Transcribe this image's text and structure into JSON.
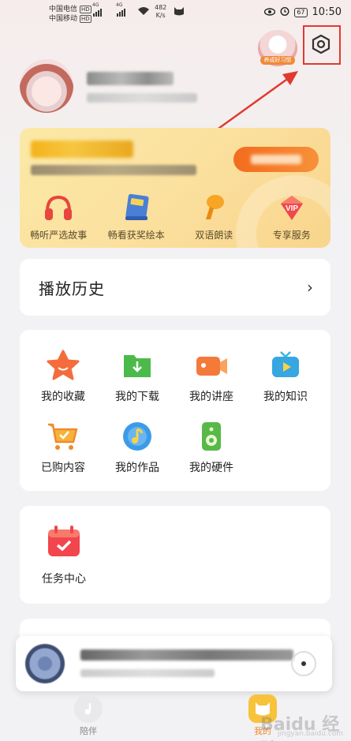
{
  "status_bar": {
    "carrier1": "中国电信",
    "carrier2": "中国移动",
    "hd": "HD",
    "network1": "4G",
    "network2": "4G",
    "speed_value": "482",
    "speed_unit": "K/s",
    "battery": "67",
    "time": "10:50"
  },
  "header": {
    "badge_label": "养成好习惯",
    "settings_icon": "gear-icon"
  },
  "vip": {
    "features": [
      {
        "label": "畅听严选故事",
        "icon": "headphones-icon"
      },
      {
        "label": "畅看获奖绘本",
        "icon": "book-icon"
      },
      {
        "label": "双语朗读",
        "icon": "microphone-icon"
      },
      {
        "label": "专享服务",
        "icon": "vip-gem-icon",
        "badge": "VIP"
      }
    ]
  },
  "history": {
    "title": "播放历史",
    "chevron": "›"
  },
  "grid": {
    "items": [
      {
        "label": "我的收藏",
        "icon": "star-icon"
      },
      {
        "label": "我的下载",
        "icon": "download-folder-icon"
      },
      {
        "label": "我的讲座",
        "icon": "video-camera-icon"
      },
      {
        "label": "我的知识",
        "icon": "tv-play-icon"
      },
      {
        "label": "已购内容",
        "icon": "shopping-cart-icon"
      },
      {
        "label": "我的作品",
        "icon": "music-disc-icon"
      },
      {
        "label": "我的硬件",
        "icon": "speaker-device-icon"
      }
    ]
  },
  "task": {
    "label": "任务中心",
    "icon": "calendar-check-icon"
  },
  "tabbar": {
    "tabs": [
      {
        "label": "陪伴",
        "icon": "music-note-icon"
      },
      {
        "label": "我的",
        "icon": "cat-face-icon"
      }
    ]
  },
  "watermark": {
    "main": "Baidu 经验",
    "sub": "jingyan.baidu.com"
  },
  "colors": {
    "highlight_box": "#e03a2e",
    "vip_card": "#fbe1a0",
    "vip_cta": "#f36b1c",
    "accent_orange": "#f7913a"
  }
}
